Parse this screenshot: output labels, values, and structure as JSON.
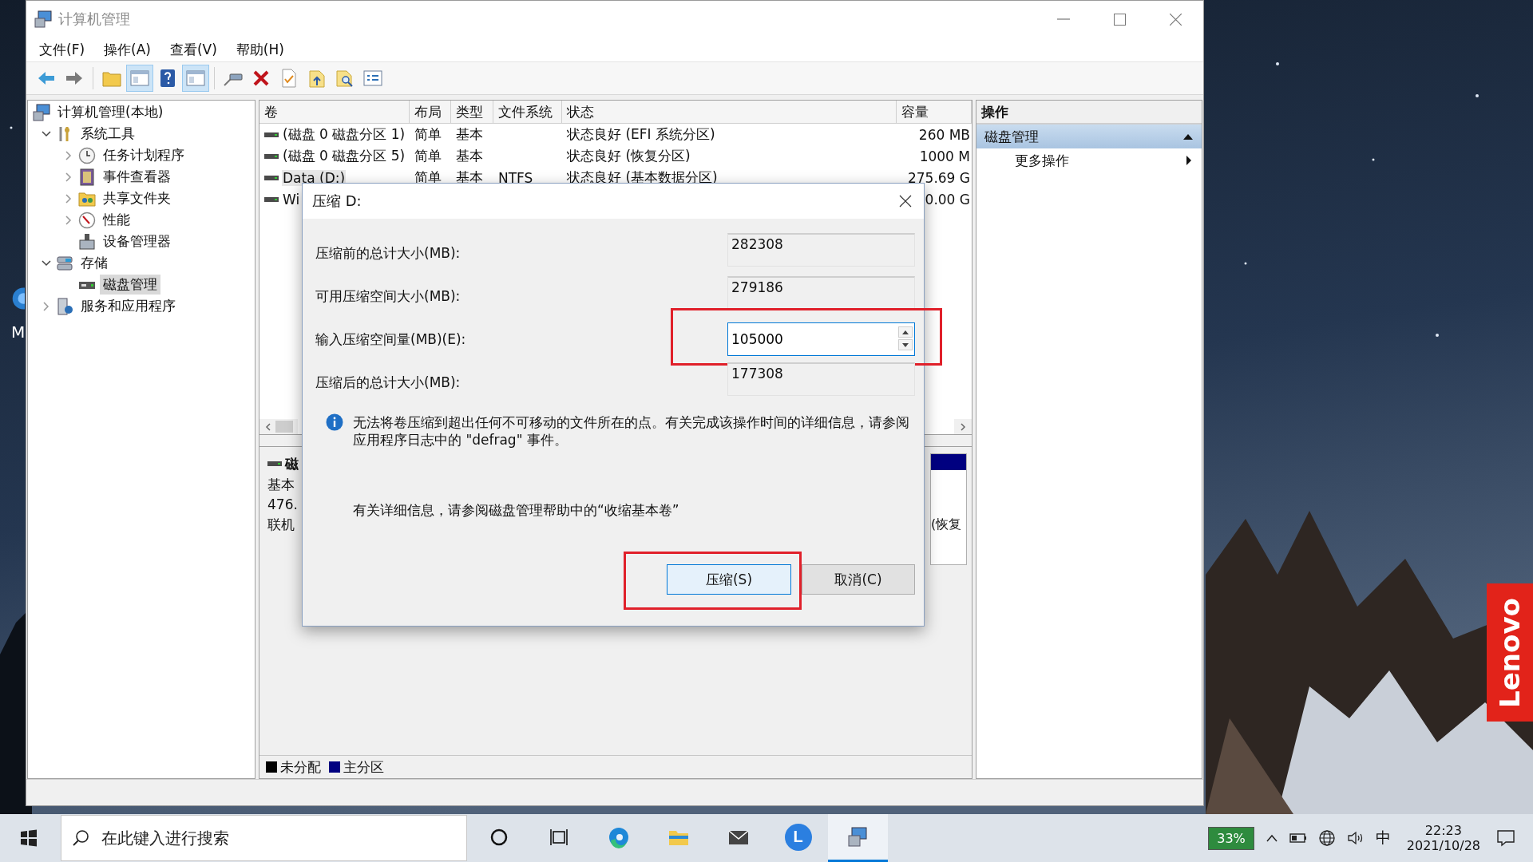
{
  "desktop": {
    "icon_label": "M",
    "brand": "Lenovo"
  },
  "window": {
    "title": "计算机管理",
    "menu": [
      "文件(F)",
      "操作(A)",
      "查看(V)",
      "帮助(H)"
    ],
    "toolbar": [
      {
        "pressed": false
      },
      {
        "pressed": false
      },
      {
        "pressed": false
      },
      {
        "pressed": true
      },
      {
        "pressed": false
      },
      {
        "pressed": true
      },
      {
        "pressed": false
      },
      {
        "pressed": false
      },
      {
        "pressed": false
      },
      {
        "pressed": false
      },
      {
        "pressed": false
      },
      {
        "pressed": false
      }
    ],
    "tree": [
      {
        "label": "计算机管理(本地)",
        "kind": "root",
        "selected": false,
        "children": [
          {
            "label": "系统工具",
            "kind": "branch",
            "expanded": true,
            "selected": false,
            "children": [
              {
                "label": "任务计划程序",
                "kind": "branch",
                "expanded": false,
                "selected": false
              },
              {
                "label": "事件查看器",
                "kind": "branch",
                "expanded": false,
                "selected": false
              },
              {
                "label": "共享文件夹",
                "kind": "branch",
                "expanded": false,
                "selected": false
              },
              {
                "label": "性能",
                "kind": "branch",
                "expanded": false,
                "selected": false
              },
              {
                "label": "设备管理器",
                "kind": "leaf",
                "selected": false
              }
            ]
          },
          {
            "label": "存储",
            "kind": "branch",
            "expanded": true,
            "selected": false,
            "children": [
              {
                "label": "磁盘管理",
                "kind": "leaf",
                "selected": true
              }
            ]
          },
          {
            "label": "服务和应用程序",
            "kind": "branch",
            "expanded": false,
            "selected": false
          }
        ]
      }
    ],
    "table": {
      "columns": [
        "卷",
        "布局",
        "类型",
        "文件系统",
        "状态",
        "容量"
      ],
      "rows": [
        {
          "volume": "(磁盘 0 磁盘分区 1)",
          "layout": "简单",
          "type": "基本",
          "status": "状态良好 (EFI 系统分区)",
          "capacity": "260 MB",
          "selected": false
        },
        {
          "volume": "(磁盘 0 磁盘分区 5)",
          "layout": "简单",
          "type": "基本",
          "status": "状态良好 (恢复分区)",
          "capacity": "1000 M",
          "selected": false
        },
        {
          "volume": "Data (D:)",
          "layout": "简单",
          "type": "基本",
          "filesystem": "NTFS",
          "status": "状态良好 (基本数据分区)",
          "capacity": "275.69 G",
          "selected": true
        },
        {
          "volume": "Wi",
          "capacity": "0.00 G",
          "selected": false
        }
      ]
    },
    "disk": {
      "name": "磁",
      "lines": [
        "基本",
        "476.",
        "联机"
      ],
      "partition": "(恢复"
    },
    "legend": [
      {
        "label": "未分配",
        "color": "#000000"
      },
      {
        "label": "主分区",
        "color": "#000080"
      }
    ],
    "actions": {
      "title": "操作",
      "items": [
        {
          "label": "磁盘管理",
          "kind": "section",
          "expanded": true
        },
        {
          "label": "更多操作",
          "kind": "submenu"
        }
      ]
    }
  },
  "dialog": {
    "title": "压缩 D:",
    "fields": [
      {
        "label": "压缩前的总计大小(MB):",
        "value": "282308",
        "kind": "readonly",
        "highlighted": false
      },
      {
        "label": "可用压缩空间大小(MB):",
        "value": "279186",
        "kind": "readonly",
        "highlighted": false
      },
      {
        "label": "输入压缩空间量(MB)(E):",
        "value": "105000",
        "kind": "spin",
        "highlighted": true
      },
      {
        "label": "压缩后的总计大小(MB):",
        "value": "177308",
        "kind": "readonly",
        "highlighted": false
      }
    ],
    "info": "无法将卷压缩到超出任何不可移动的文件所在的点。有关完成该操作时间的详细信息，请参阅应用程序日志中的 \"defrag\" 事件。",
    "help": "有关详细信息，请参阅磁盘管理帮助中的“收缩基本卷”",
    "buttons": [
      {
        "label": "压缩(S)",
        "default": true,
        "highlighted": true
      },
      {
        "label": "取消(C)",
        "default": false,
        "highlighted": false
      }
    ]
  },
  "taskbar": {
    "search": {
      "placeholder": "在此键入进行搜索"
    },
    "apps": [
      {
        "active": false
      },
      {
        "active": false
      },
      {
        "active": false
      },
      {
        "active": false
      },
      {
        "active": false
      },
      {
        "active": false,
        "label": "L"
      },
      {
        "active": true
      }
    ],
    "battery": "33%",
    "language": "中",
    "time": "22:23",
    "date": "2021/10/28"
  }
}
